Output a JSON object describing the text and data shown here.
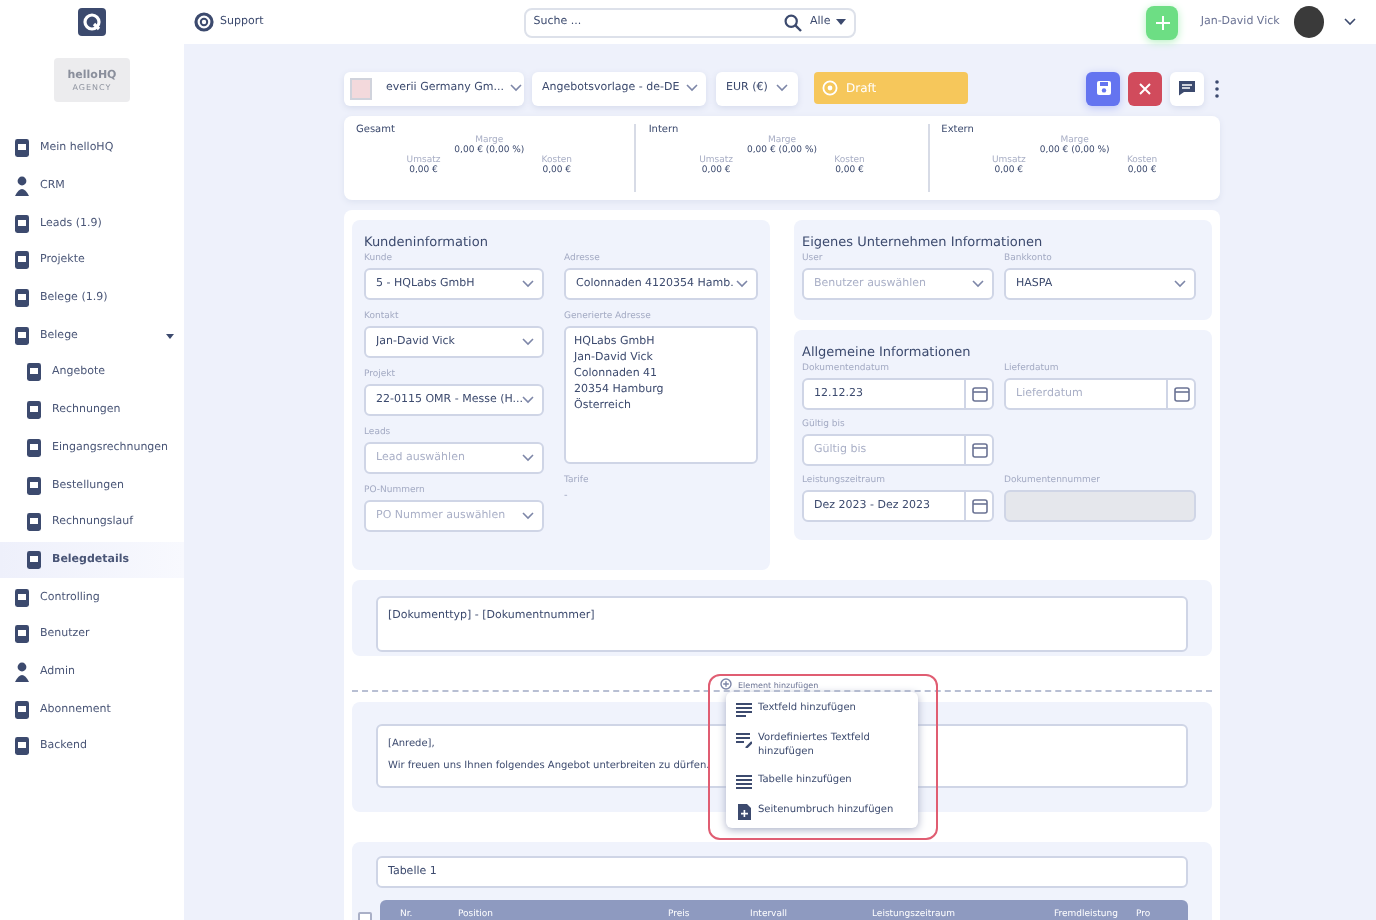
{
  "topbar": {
    "support": "Support",
    "search": {
      "placeholder": "Suche ...",
      "filter": "Alle"
    },
    "user": "Jan-David Vick"
  },
  "sidebar": {
    "brand": "helloHQ",
    "brand_sub": "AGENCY",
    "items": [
      {
        "label": "Mein helloHQ",
        "selected": false
      },
      {
        "label": "CRM",
        "selected": false
      },
      {
        "label": "Leads (1.9)",
        "selected": false
      },
      {
        "label": "Projekte",
        "selected": false
      },
      {
        "label": "Belege (1.9)",
        "selected": false
      },
      {
        "label": "Belege",
        "selected": false,
        "expanded": true,
        "children": [
          {
            "label": "Angebote",
            "selected": false
          },
          {
            "label": "Rechnungen",
            "selected": false
          },
          {
            "label": "Eingangsrechnungen",
            "selected": false
          },
          {
            "label": "Bestellungen",
            "selected": false
          },
          {
            "label": "Rechnungslauf",
            "selected": false
          },
          {
            "label": "Belegdetails",
            "selected": true
          }
        ]
      },
      {
        "label": "Controlling",
        "selected": false
      },
      {
        "label": "Benutzer",
        "selected": false
      },
      {
        "label": "Admin",
        "selected": false
      },
      {
        "label": "Abonnement",
        "selected": false
      },
      {
        "label": "Backend",
        "selected": false
      }
    ]
  },
  "toolbar": {
    "company": "everii Germany Gm...",
    "template": "Angebotsvorlage - de-DE",
    "currency": "EUR (€)",
    "status": "Draft"
  },
  "summary": [
    {
      "title": "Gesamt",
      "margin_label": "Marge",
      "margin": "0,00 € (0,00 %)",
      "revenue_label": "Umsatz",
      "revenue": "0,00 €",
      "cost_label": "Kosten",
      "cost": "0,00 €"
    },
    {
      "title": "Intern",
      "margin_label": "Marge",
      "margin": "0,00 € (0,00 %)",
      "revenue_label": "Umsatz",
      "revenue": "0,00 €",
      "cost_label": "Kosten",
      "cost": "0,00 €"
    },
    {
      "title": "Extern",
      "margin_label": "Marge",
      "margin": "0,00 € (0,00 %)",
      "revenue_label": "Umsatz",
      "revenue": "0,00 €",
      "cost_label": "Kosten",
      "cost": "0,00 €"
    }
  ],
  "customer": {
    "title": "Kundeninformation",
    "left": [
      {
        "kind": "select",
        "label": "Kunde",
        "value": "5 - HQLabs GmbH"
      },
      {
        "kind": "select",
        "label": "Kontakt",
        "value": "Jan-David Vick"
      },
      {
        "kind": "select",
        "label": "Projekt",
        "value": "22-0115 OMR - Messe (H..."
      },
      {
        "kind": "select",
        "label": "Leads",
        "placeholder": "Lead auswählen"
      },
      {
        "kind": "select",
        "label": "PO-Nummern",
        "placeholder": "PO Nummer auswählen"
      }
    ],
    "right": [
      {
        "kind": "select",
        "label": "Adresse",
        "value": "Colonnaden 4120354 Hamb."
      },
      {
        "kind": "textarea",
        "label": "Generierte Adresse",
        "value": "HQLabs GmbH\nJan-David Vick\nColonnaden 41\n20354 Hamburg\nÖsterreich"
      },
      {
        "kind": "plain",
        "label": "Tarife",
        "value": "-"
      }
    ]
  },
  "company": {
    "title": "Eigenes Unternehmen Informationen",
    "fields": [
      {
        "kind": "select",
        "label": "User",
        "placeholder": "Benutzer auswählen"
      },
      {
        "kind": "select",
        "label": "Bankkonto",
        "value": "HASPA"
      }
    ]
  },
  "general": {
    "title": "Allgemeine Informationen",
    "fields": [
      {
        "kind": "date",
        "label": "Dokumentendatum",
        "value": "12.12.23"
      },
      {
        "kind": "date",
        "label": "Lieferdatum",
        "placeholder": "Lieferdatum"
      },
      {
        "kind": "date",
        "label": "Gültig bis",
        "placeholder": "Gültig bis"
      },
      {
        "kind": "blank"
      },
      {
        "kind": "date",
        "label": "Leistungszeitraum",
        "value": "Dez 2023 - Dez 2023"
      },
      {
        "kind": "disabled",
        "label": "Dokumentennummer"
      }
    ]
  },
  "heading_block": {
    "lines": [
      "[Dokumenttyp] - [Dokumentnummer]"
    ]
  },
  "add_element": {
    "label": "Element hinzufügen",
    "highlighted": true,
    "menu": [
      "Textfeld hinzufügen",
      "Vordefiniertes Textfeld hinzufügen",
      "Tabelle hinzufügen",
      "Seitenumbruch hinzufügen"
    ]
  },
  "salutation_block": {
    "lines": [
      "[Anrede],",
      "Wir freuen uns Ihnen folgendes Angebot unterbreiten zu dürfen."
    ]
  },
  "table": {
    "title": "Tabelle 1",
    "select_all": {
      "checked": false
    },
    "columns": [
      "Nr.",
      "Position",
      "Preis",
      "Intervall",
      "Leistungszeitraum",
      "Fremdleistung",
      "Pro"
    ]
  }
}
